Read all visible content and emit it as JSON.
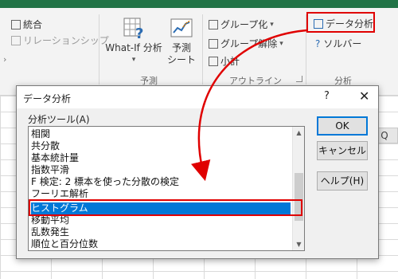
{
  "ribbon": {
    "outline_items": {
      "consolidate": "統合",
      "relationships": "リレーションシップ"
    },
    "forecast": {
      "whatif_label": "What-If 分析",
      "forecast_sheet_line1": "予測",
      "forecast_sheet_line2": "シート",
      "group_label": "予測"
    },
    "outline": {
      "group": "グループ化",
      "ungroup": "グループ解除",
      "subtotal": "小計",
      "group_label": "アウトライン"
    },
    "analysis": {
      "data_analysis": "データ分析",
      "solver": "ソルバー",
      "group_label": "分析"
    }
  },
  "sheet": {
    "column_q": "Q"
  },
  "dialog": {
    "title": "データ分析",
    "help_icon": "?",
    "close_icon": "✕",
    "list_label": "分析ツール(A)",
    "tools": [
      "相関",
      "共分散",
      "基本統計量",
      "指数平滑",
      "F 検定: 2 標本を使った分散の検定",
      "フーリエ解析",
      "ヒストグラム",
      "移動平均",
      "乱数発生",
      "順位と百分位数"
    ],
    "selected_index": 6,
    "ok_button": "OK",
    "cancel_button": "キャンセル",
    "help_button": "ヘルプ(H)"
  },
  "colors": {
    "title_green": "#217346",
    "selection_blue": "#0078d7",
    "highlight_red": "#e00000"
  }
}
